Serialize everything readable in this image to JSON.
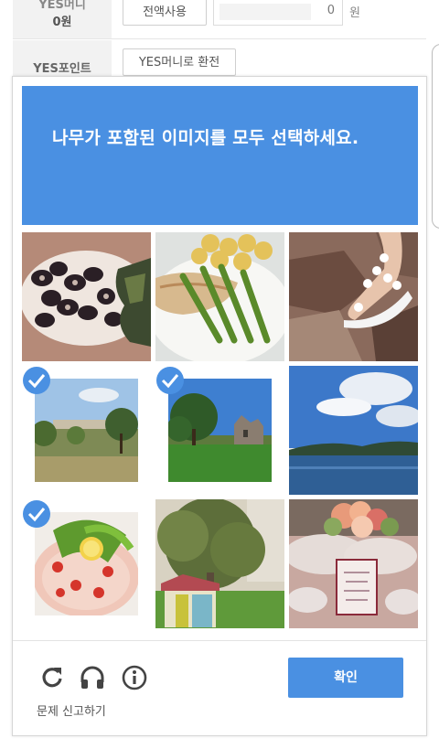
{
  "background": {
    "row1_label_top": "YES머니",
    "row1_label_value": "0원",
    "use_all_button": "전액사용",
    "amount_value": "0",
    "currency_unit": "원",
    "row2_label": "YES포인트",
    "convert_button": "YES머니로 환전"
  },
  "captcha": {
    "instruction": "나무가 포함된 이미지를 모두 선택하세요.",
    "accent_color": "#4a90e2",
    "tiles": [
      {
        "content": "black olives and salad",
        "selected": false
      },
      {
        "content": "grilled fish with asparagus and potatoes",
        "selected": false
      },
      {
        "content": "foot in sandal on rock",
        "selected": false
      },
      {
        "content": "trees and building",
        "selected": true
      },
      {
        "content": "trees and castle ruins",
        "selected": true
      },
      {
        "content": "lake and cloudy sky",
        "selected": false
      },
      {
        "content": "carpaccio with salad and lemon",
        "selected": true
      },
      {
        "content": "olive tree and small house",
        "selected": false
      },
      {
        "content": "wedding table setting",
        "selected": false
      }
    ],
    "icons": [
      "reload-icon",
      "headphones-icon",
      "info-icon"
    ],
    "verify_button": "확인",
    "report_link": "문제 신고하기"
  }
}
